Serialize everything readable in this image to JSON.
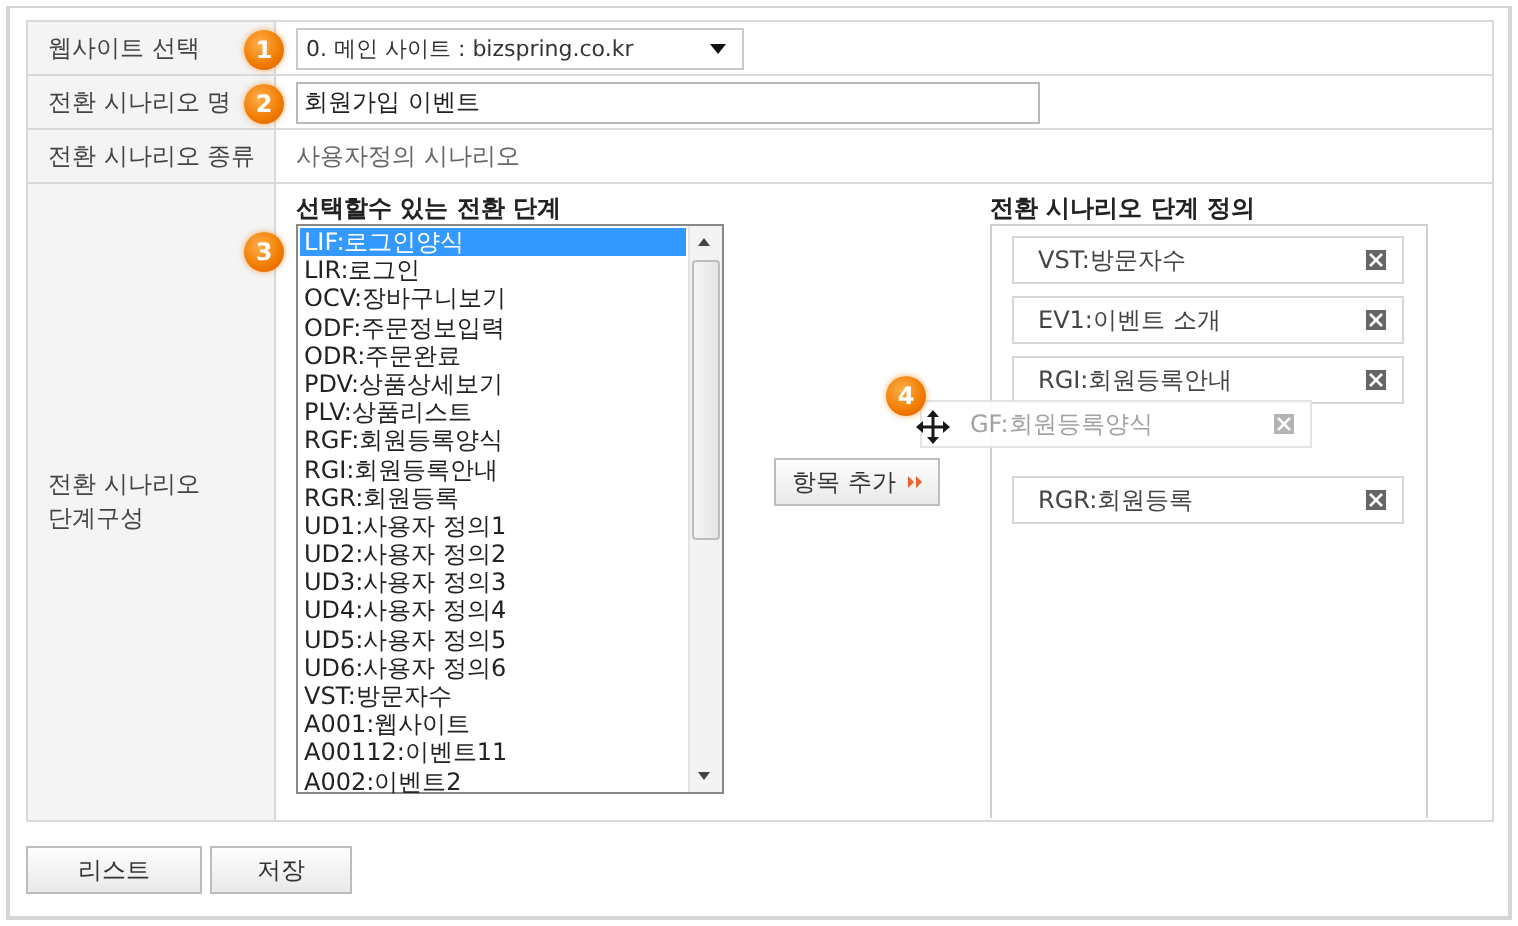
{
  "fields": [
    {
      "label": "웹사이트 선택",
      "badge": "1",
      "kind": "select",
      "value": "0. 메인 사이트 : bizspring.co.kr"
    },
    {
      "label": "전환 시나리오 명",
      "badge": "2",
      "kind": "input",
      "value": "회원가입 이벤트"
    },
    {
      "label": "전환 시나리오 종류",
      "kind": "text",
      "value": "사용자정의 시나리오"
    }
  ],
  "steps_section": {
    "label": "전환 시나리오 단계구성",
    "available": {
      "title": "선택할수 있는 전환 단계",
      "badge": "3",
      "items": [
        {
          "label": "LIF:로그인양식",
          "selected": true
        },
        {
          "label": "LIR:로그인",
          "selected": false
        },
        {
          "label": "OCV:장바구니보기",
          "selected": false
        },
        {
          "label": "ODF:주문정보입력",
          "selected": false
        },
        {
          "label": "ODR:주문완료",
          "selected": false
        },
        {
          "label": "PDV:상품상세보기",
          "selected": false
        },
        {
          "label": "PLV:상품리스트",
          "selected": false
        },
        {
          "label": "RGF:회원등록양식",
          "selected": false
        },
        {
          "label": "RGI:회원등록안내",
          "selected": false
        },
        {
          "label": "RGR:회원등록",
          "selected": false
        },
        {
          "label": "UD1:사용자 정의1",
          "selected": false
        },
        {
          "label": "UD2:사용자 정의2",
          "selected": false
        },
        {
          "label": "UD3:사용자 정의3",
          "selected": false
        },
        {
          "label": "UD4:사용자 정의4",
          "selected": false
        },
        {
          "label": "UD5:사용자 정의5",
          "selected": false
        },
        {
          "label": "UD6:사용자 정의6",
          "selected": false
        },
        {
          "label": "VST:방문자수",
          "selected": false
        },
        {
          "label": "A001:웹사이트",
          "selected": false
        },
        {
          "label": "A00112:이벤트11",
          "selected": false
        },
        {
          "label": "A002:이벤트2",
          "selected": false
        }
      ]
    },
    "add_button": "항목 추가",
    "defined": {
      "title": "전환 시나리오 단계 정의",
      "items": [
        {
          "kind": "placed",
          "label": "VST:방문자수"
        },
        {
          "kind": "placed",
          "label": "EV1:이벤트 소개"
        },
        {
          "kind": "placed",
          "label": "RGI:회원등록안내"
        },
        {
          "kind": "dragging",
          "label": "GF:회원등록양식",
          "badge": "4"
        },
        {
          "kind": "placed",
          "label": "RGR:회원등록"
        }
      ]
    }
  },
  "buttons": [
    "리스트",
    "저장"
  ]
}
